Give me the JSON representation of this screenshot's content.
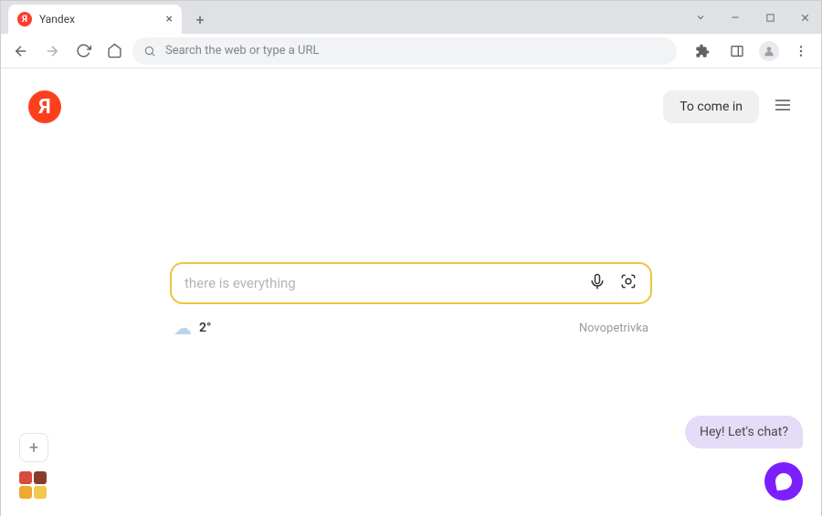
{
  "browser": {
    "tab_title": "Yandex",
    "omnibox_placeholder": "Search the web or type a URL"
  },
  "page": {
    "logo_letter": "Я",
    "login_label": "To come in",
    "search_placeholder": "there is everything",
    "weather_temp": "2°",
    "location": "Novopetrivka",
    "chat_prompt": "Hey! Let's chat?"
  }
}
